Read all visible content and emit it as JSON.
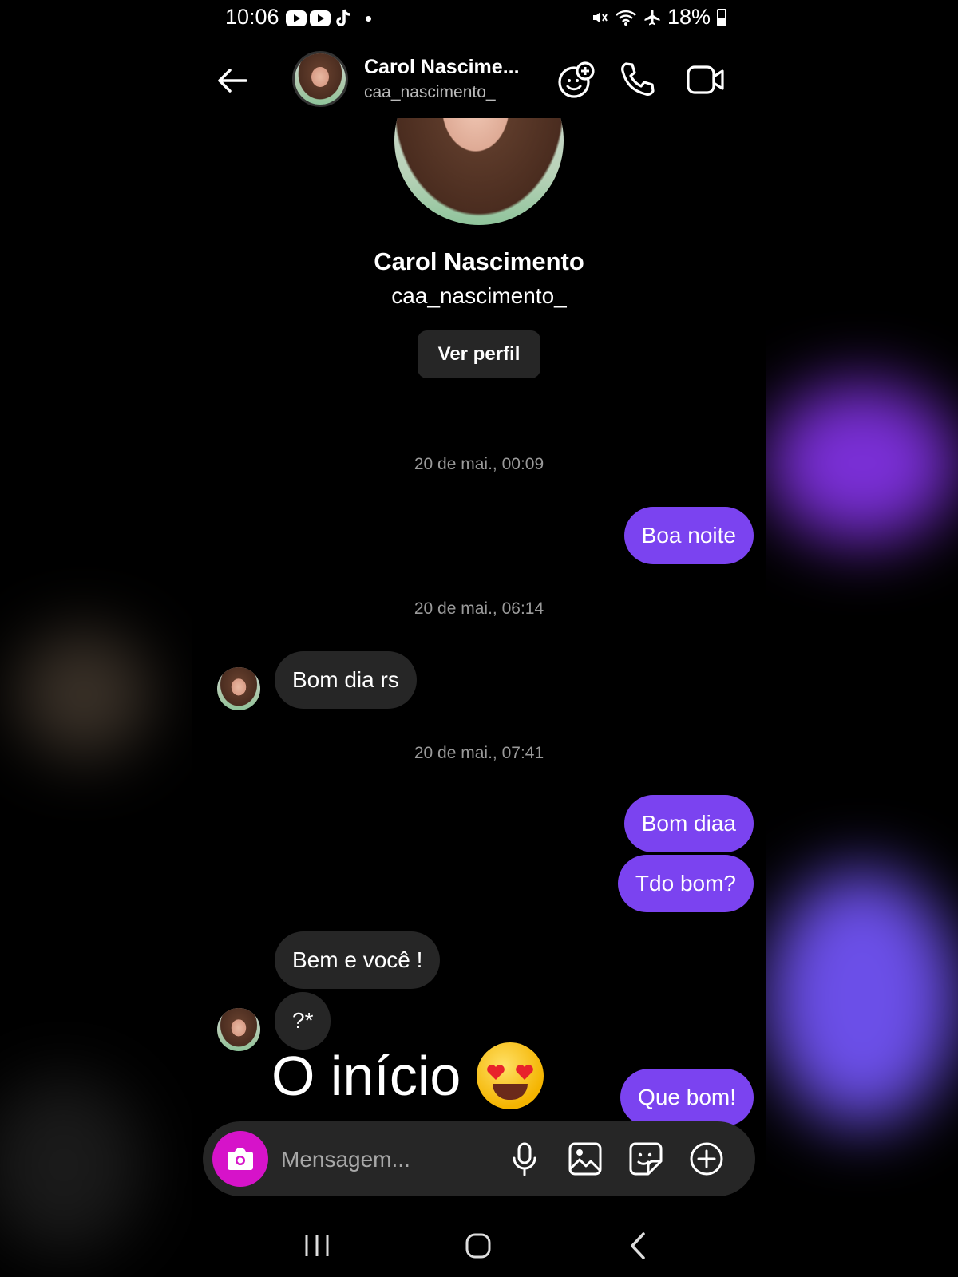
{
  "status_bar": {
    "time": "10:06",
    "battery": "18%"
  },
  "header": {
    "name": "Carol Nascime...",
    "username": "caa_nascimento_"
  },
  "profile": {
    "name": "Carol Nascimento",
    "username": "caa_nascimento_",
    "view_profile_label": "Ver perfil"
  },
  "messages": [
    {
      "type": "timestamp",
      "text": "20 de mai., 00:09"
    },
    {
      "type": "sent",
      "text": "Boa noite"
    },
    {
      "type": "timestamp",
      "text": "20 de mai., 06:14"
    },
    {
      "type": "received",
      "text": "Bom dia rs"
    },
    {
      "type": "timestamp",
      "text": "20 de mai., 07:41"
    },
    {
      "type": "sent",
      "text": "Bom diaa"
    },
    {
      "type": "sent",
      "text": "Tdo bom?"
    },
    {
      "type": "received",
      "text": "Bem e você !"
    },
    {
      "type": "received",
      "text": "?*"
    },
    {
      "type": "sent",
      "text": "Que bom!"
    }
  ],
  "overlay_caption": "O início",
  "composer": {
    "placeholder": "Mensagem..."
  },
  "colors": {
    "sent_bubble": "#7b43f0",
    "received_bubble": "#262626",
    "camera_button": "#d613c9",
    "background": "#000000"
  }
}
